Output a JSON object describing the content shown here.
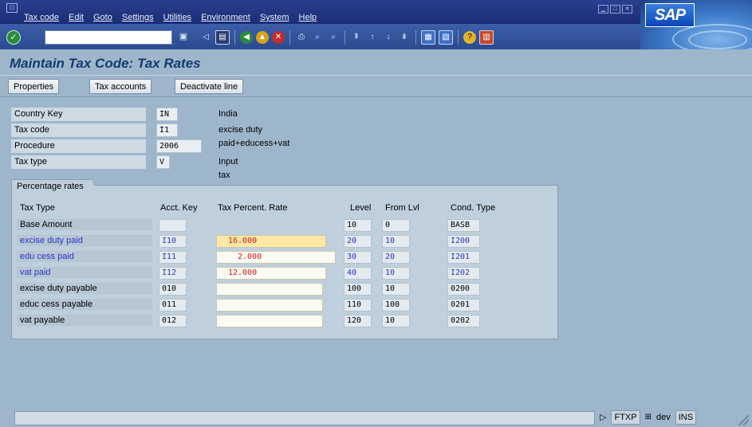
{
  "menu": [
    "Tax code",
    "Edit",
    "Goto",
    "Settings",
    "Utilities",
    "Environment",
    "System",
    "Help"
  ],
  "brand": "SAP",
  "title": "Maintain Tax Code: Tax Rates",
  "app_toolbar": {
    "properties": "Properties",
    "tax_accounts": "Tax accounts",
    "deactivate_line": "Deactivate line"
  },
  "header": {
    "country_key": {
      "label": "Country Key",
      "value": "IN",
      "desc": "India"
    },
    "tax_code": {
      "label": "Tax code",
      "value": "I1",
      "desc": "excise duty paid+educess+vat"
    },
    "procedure": {
      "label": "Procedure",
      "value": "2006"
    },
    "tax_type": {
      "label": "Tax type",
      "value": "V",
      "desc": "Input tax"
    }
  },
  "rates": {
    "group_title": "Percentage rates",
    "columns": {
      "tax_type": "Tax Type",
      "acct_key": "Acct. Key",
      "rate": "Tax Percent. Rate",
      "level": "Level",
      "from_lvl": "From Lvl",
      "cond_type": "Cond. Type"
    },
    "rows": [
      {
        "type": "Base Amount",
        "key": "",
        "rate": "",
        "level": "10",
        "from": "0",
        "cond": "BASB"
      },
      {
        "type": "excise duty paid",
        "key": "I10",
        "rate": "16.000",
        "level": "20",
        "from": "10",
        "cond": "I200"
      },
      {
        "type": "edu cess paid",
        "key": "I11",
        "rate": "2.000",
        "level": "30",
        "from": "20",
        "cond": "I201"
      },
      {
        "type": "vat paid",
        "key": "I12",
        "rate": "12.000",
        "level": "40",
        "from": "10",
        "cond": "I202"
      },
      {
        "type": "excise duty payable",
        "key": "010",
        "rate": "",
        "level": "100",
        "from": "10",
        "cond": "0200"
      },
      {
        "type": "educ cess payable",
        "key": "011",
        "rate": "",
        "level": "110",
        "from": "100",
        "cond": "0201"
      },
      {
        "type": "vat payable",
        "key": "012",
        "rate": "",
        "level": "120",
        "from": "10",
        "cond": "0202"
      }
    ]
  },
  "status": {
    "transaction": "FTXP",
    "client": "dev",
    "mode": "INS"
  },
  "colors": {
    "menubar": "#1b2d76",
    "background": "#9db6cc",
    "title_text": "#173b6b",
    "blue_text": "#2a35c8",
    "rate_text": "#c81c1c",
    "highlight": "#ffe7a6"
  }
}
